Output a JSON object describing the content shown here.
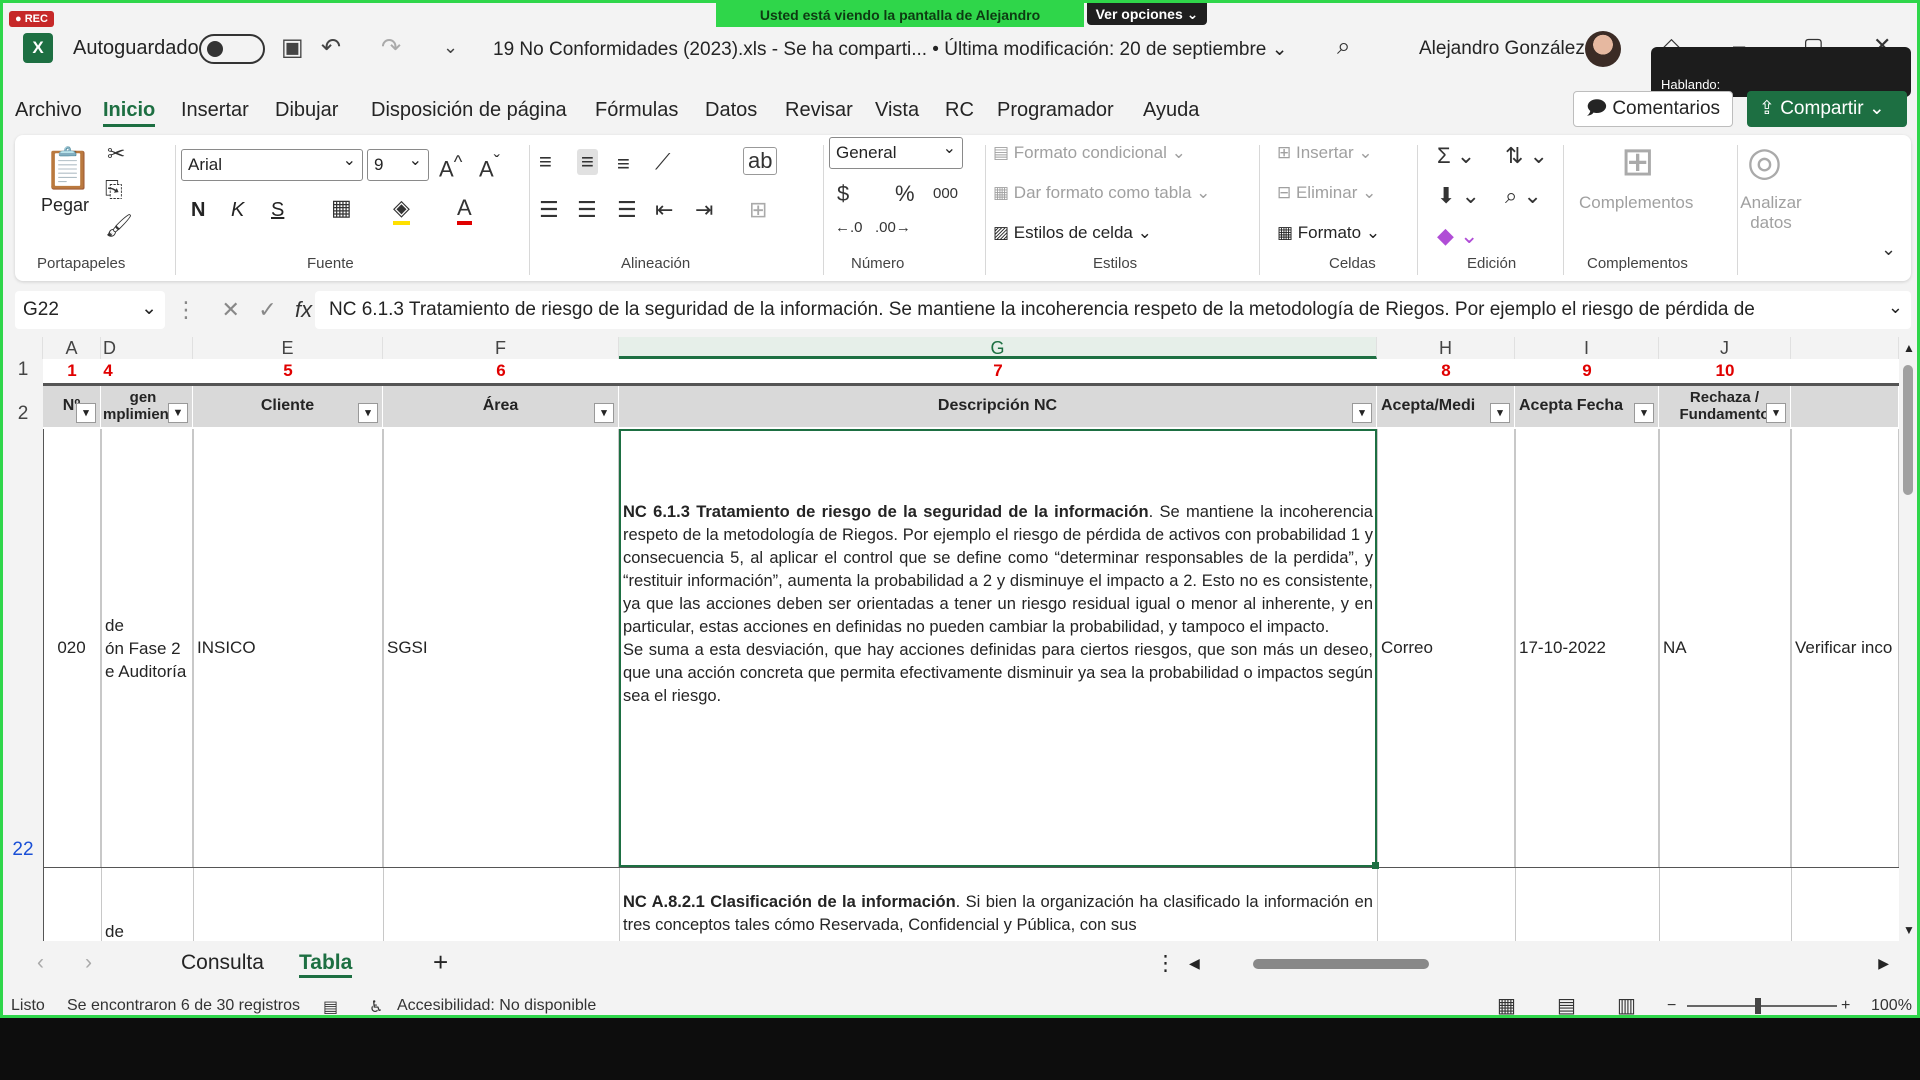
{
  "recording": {
    "badge": "● REC"
  },
  "share_banner": {
    "text": "Usted está viendo la pantalla de  Alejandro",
    "options": "Ver opciones ⌄"
  },
  "titlebar": {
    "autosave_label": "Autoguardado",
    "doc_title": "19 No Conformidades (2023).xls  -  Se ha comparti...  • Última modificación: 20 de septiembre ⌄",
    "user_name": "Alejandro González",
    "speaking_label": "Hablando:"
  },
  "menu": {
    "items": [
      "Archivo",
      "Inicio",
      "Insertar",
      "Dibujar",
      "Disposición de página",
      "Fórmulas",
      "Datos",
      "Revisar",
      "Vista",
      "RC",
      "Programador",
      "Ayuda"
    ],
    "comments_label": "Comentarios",
    "share_label": "Compartir"
  },
  "ribbon": {
    "paste_label": "Pegar",
    "font_name": "Arial",
    "font_size": "9",
    "number_format": "General",
    "conditional_format": "Formato condicional ⌄",
    "format_as_table": "Dar formato como tabla ⌄",
    "cell_styles": "Estilos de celda ⌄",
    "insert": "Insertar",
    "delete": "Eliminar",
    "format": "Formato ⌄",
    "addins": "Complementos",
    "analyze": "Analizar datos",
    "bold": "N",
    "italic": "K",
    "underline": "S",
    "groups": {
      "clipboard": "Portapapeles",
      "font": "Fuente",
      "alignment": "Alineación",
      "number": "Número",
      "styles": "Estilos",
      "cells": "Celdas",
      "editing": "Edición",
      "addins": "Complementos"
    }
  },
  "formula_bar": {
    "cell_ref": "G22",
    "formula": "NC 6.1.3 Tratamiento de riesgo de la seguridad de la información. Se mantiene la incoherencia respeto de la metodología de Riegos. Por ejemplo el riesgo de pérdida de"
  },
  "grid": {
    "columns": [
      "A",
      "D",
      "E",
      "F",
      "G",
      "H",
      "I",
      "J"
    ],
    "red_numbers": [
      "1",
      "4",
      "5",
      "6",
      "7",
      "8",
      "9",
      "10"
    ],
    "headers": [
      "Nº",
      "gen\nmplimiento",
      "Cliente",
      "Área",
      "Descripción NC",
      "Acepta/Medi",
      "Acepta Fecha",
      "Rechaza /\nFundamento"
    ],
    "row_numbers": [
      "1",
      "2",
      "22"
    ],
    "row22": {
      "n": "020",
      "origen": "de\nón Fase 2\ne Auditoría",
      "cliente": "INSICO",
      "area": "SGSI",
      "desc_bold": "NC 6.1.3 Tratamiento de riesgo de la seguridad de la información",
      "desc_rest": ". Se mantiene la incoherencia respeto de la metodología de Riegos. Por ejemplo el riesgo de pérdida de activos con probabilidad 1 y consecuencia 5, al aplicar el control que se define como “determinar responsables de la perdida”, y “restituir información”, aumenta la probabilidad a 2 y disminuye el impacto a 2. Esto no es consistente, ya que las acciones deben ser orientadas a tener un riesgo residual igual o menor al inherente, y en particular, estas acciones en definidas no pueden cambiar la probabilidad, y tampoco el impacto.",
      "desc_para2": "Se suma a esta desviación, que hay acciones definidas para ciertos riesgos, que son más un deseo, que una acción concreta que permita efectivamente disminuir ya sea la probabilidad o impactos según sea el riesgo.",
      "acepta": "Correo",
      "fecha": "17-10-2022",
      "rechaza": "NA",
      "extra": "Verificar inco"
    },
    "row23": {
      "origen": "de",
      "desc_bold": "NC A.8.2.1 Clasificación de la información",
      "desc_rest": ". Si bien la organización ha clasificado la información en tres conceptos tales cómo Reservada, Confidencial y Pública, con sus"
    }
  },
  "sheets": {
    "tabs": [
      "Consulta",
      "Tabla"
    ],
    "active": "Tabla"
  },
  "status": {
    "ready": "Listo",
    "records": "Se encontraron 6 de 30 registros",
    "accessibility": "Accesibilidad: No disponible",
    "zoom": "100%"
  }
}
